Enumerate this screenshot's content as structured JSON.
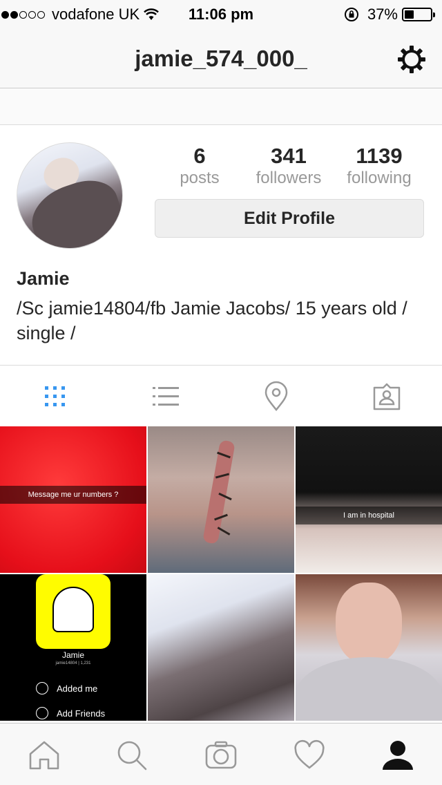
{
  "status_bar": {
    "carrier": "vodafone UK",
    "time": "11:06 pm",
    "battery": "37%",
    "battery_level": 0.37,
    "signal_bars_filled": 2,
    "signal_bars_total": 5
  },
  "nav": {
    "title": "jamie_574_000_",
    "settings_icon": "gear-icon"
  },
  "profile": {
    "stats": [
      {
        "value": "6",
        "label": "posts"
      },
      {
        "value": "341",
        "label": "followers"
      },
      {
        "value": "1139",
        "label": "following"
      }
    ],
    "edit_button": "Edit Profile",
    "name": "Jamie",
    "bio": "/Sc jamie14804/fb Jamie Jacobs/ 15 years old / single /"
  },
  "view_tabs": [
    {
      "icon": "grid-icon",
      "active": true
    },
    {
      "icon": "list-icon",
      "active": false
    },
    {
      "icon": "location-pin-icon",
      "active": false
    },
    {
      "icon": "tagged-icon",
      "active": false
    }
  ],
  "posts": [
    {
      "caption": "Message me ur numbers ?"
    },
    {
      "caption": ""
    },
    {
      "caption": "I am in hospital"
    },
    {
      "snap_name": "Jamie",
      "snap_sub": "jamie14804 | 1,231",
      "row1": "Added me",
      "row2": "Add Friends"
    },
    {
      "caption": ""
    },
    {
      "caption": ""
    }
  ],
  "tab_bar": [
    {
      "icon": "home-icon"
    },
    {
      "icon": "search-icon"
    },
    {
      "icon": "camera-icon"
    },
    {
      "icon": "heart-icon"
    },
    {
      "icon": "profile-icon",
      "active": true
    }
  ],
  "colors": {
    "active_tab": "#3897f0",
    "inactive_icon": "#999999",
    "text": "#262626"
  }
}
